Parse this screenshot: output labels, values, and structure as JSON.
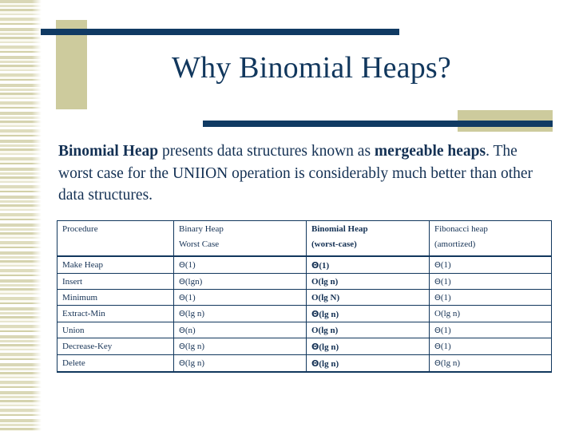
{
  "slide": {
    "title": "Why Binomial Heaps?",
    "body": {
      "seg1_bold": "Binomial Heap",
      "seg2": " presents data structures known as ",
      "seg3_bold": "mergeable heaps",
      "seg4": ". The worst case for the UNIION operation is considerably much better than other data structures."
    },
    "colors": {
      "navy": "#11375d",
      "khaki": "#cdcb9d",
      "text": "#143154",
      "background": "#ffffff"
    }
  },
  "table": {
    "headers": [
      {
        "line1": "Procedure",
        "line2": "",
        "bold": false
      },
      {
        "line1": "Binary Heap",
        "line2": "Worst Case",
        "bold": false
      },
      {
        "line1": "Binomial Heap",
        "line2": "(worst-case)",
        "bold": true
      },
      {
        "line1": "Fibonacci heap",
        "line2": "(amortized)",
        "bold": false
      }
    ],
    "rows": [
      {
        "procedure": "Make Heap",
        "binary": "Θ(1)",
        "binomial": "Θ(1)",
        "fibonacci": "Θ(1)"
      },
      {
        "procedure": "Insert",
        "binary": "Θ(lgn)",
        "binomial": "O(lg n)",
        "fibonacci": "Θ(1)"
      },
      {
        "procedure": "Minimum",
        "binary": "Θ(1)",
        "binomial": "O(lg N)",
        "fibonacci": "Θ(1)"
      },
      {
        "procedure": "Extract-Min",
        "binary": "Θ(lg n)",
        "binomial": "Θ(lg n)",
        "fibonacci": "O(lg n)"
      },
      {
        "procedure": "Union",
        "binary": "Θ(n)",
        "binomial": "O(lg n)",
        "fibonacci": "Θ(1)"
      },
      {
        "procedure": "Decrease-Key",
        "binary": "Θ(lg n)",
        "binomial": "Θ(lg n)",
        "fibonacci": "Θ(1)"
      },
      {
        "procedure": "Delete",
        "binary": "Θ(lg n)",
        "binomial": "Θ(lg n)",
        "fibonacci": "Θ(lg n)"
      }
    ]
  }
}
